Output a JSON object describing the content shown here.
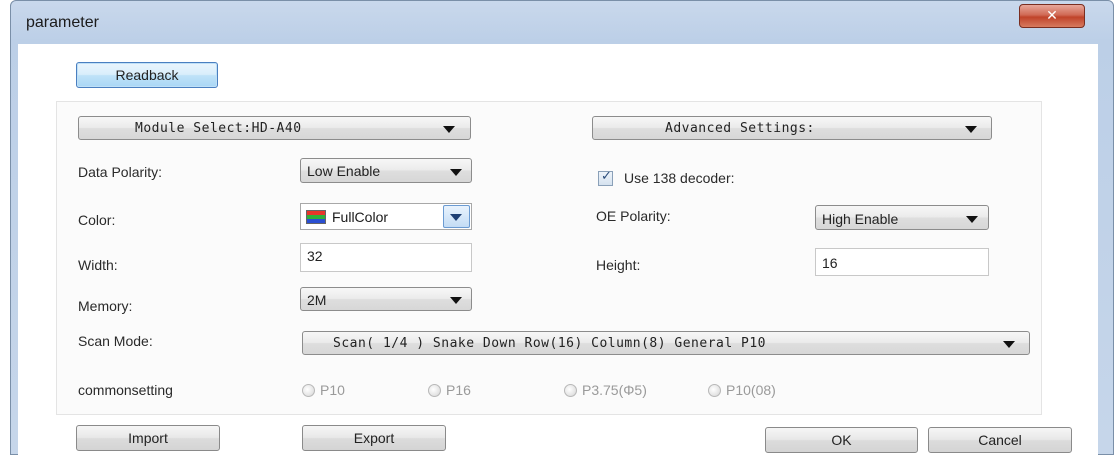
{
  "window": {
    "title": "parameter",
    "close_glyph": "✕"
  },
  "toolbar": {
    "readback_label": "Readback"
  },
  "module_select": {
    "value": "Module Select:HD-A40"
  },
  "advanced_settings": {
    "value": "Advanced Settings:"
  },
  "fields": {
    "data_polarity": {
      "label": "Data Polarity:",
      "value": "Low Enable"
    },
    "color": {
      "label": "Color:",
      "value": "FullColor"
    },
    "width": {
      "label": "Width:",
      "value": "32"
    },
    "memory": {
      "label": "Memory:",
      "value": "2M"
    },
    "scan_mode": {
      "label": "Scan Mode:",
      "value": "Scan( 1/4 ) Snake Down Row(16) Column(8) General P10"
    },
    "use_138_decoder": {
      "label": "Use 138 decoder:",
      "checked": true
    },
    "oe_polarity": {
      "label": "OE Polarity:",
      "value": "High Enable"
    },
    "height": {
      "label": "Height:",
      "value": "16"
    }
  },
  "commonsetting": {
    "label": "commonsetting",
    "options": [
      "P10",
      "P16",
      "P3.75(Φ5)",
      "P10(08)"
    ]
  },
  "footer": {
    "import_label": "Import",
    "export_label": "Export",
    "ok_label": "OK",
    "cancel_label": "Cancel"
  },
  "icons": {
    "close": "close-icon",
    "dropdown": "chevron-down-icon",
    "color_swatch": "color-palette-icon",
    "checkbox": "checkmark-icon"
  }
}
